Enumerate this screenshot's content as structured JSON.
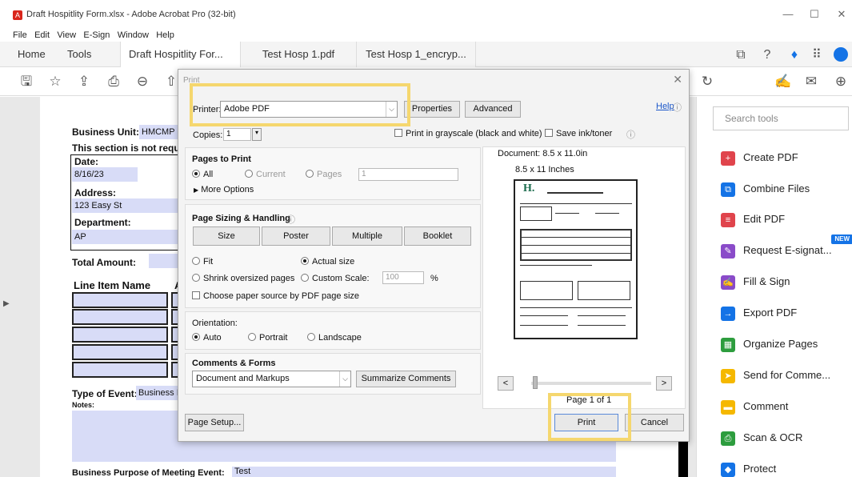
{
  "window": {
    "title": "Draft Hospitlity Form.xlsx - Adobe Acrobat Pro (32-bit)",
    "minimize": "—",
    "maximize": "☐",
    "close": "✕"
  },
  "menu": [
    "File",
    "Edit",
    "View",
    "E-Sign",
    "Window",
    "Help"
  ],
  "tabs": {
    "home": "Home",
    "tools": "Tools",
    "docs": [
      {
        "label": "Draft Hospitlity For...",
        "close": "×"
      },
      {
        "label": "Test Hosp 1.pdf"
      },
      {
        "label": "Test Hosp 1_encryp..."
      }
    ]
  },
  "document": {
    "business_unit_label": "Business Unit:",
    "business_unit_value": "HMCMP",
    "section_note": "This section is not requir",
    "date_label": "Date:",
    "date_value": "8/16/23",
    "address_label": "Address:",
    "address_value": "123 Easy St",
    "department_label": "Department:",
    "department_value": "AP",
    "total_amount_label": "Total Amount:",
    "line_item_label": "Line Item Name",
    "line_item_col2": "A",
    "type_of_event_label": "Type of Event:",
    "type_of_event_value": "Business I",
    "notes_label": "Notes:",
    "business_purpose_label": "Business Purpose of Meeting Event:",
    "business_purpose_value": "Test"
  },
  "tools_pane": {
    "search_placeholder": "Search tools",
    "items": [
      {
        "label": "Create PDF",
        "color": "#e0444c"
      },
      {
        "label": "Combine Files",
        "color": "#1473e6"
      },
      {
        "label": "Edit PDF",
        "color": "#e0444c"
      },
      {
        "label": "Request E-signat...",
        "color": "#8a4bc9",
        "badge": "NEW"
      },
      {
        "label": "Fill & Sign",
        "color": "#8a4bc9"
      },
      {
        "label": "Export PDF",
        "color": "#1473e6"
      },
      {
        "label": "Organize Pages",
        "color": "#2d9d3e"
      },
      {
        "label": "Send for Comme...",
        "color": "#f5b800"
      },
      {
        "label": "Comment",
        "color": "#f5b800"
      },
      {
        "label": "Scan & OCR",
        "color": "#2d9d3e"
      },
      {
        "label": "Protect",
        "color": "#1473e6"
      }
    ]
  },
  "print_dialog": {
    "title": "Print",
    "printer_label": "Printer:",
    "printer_value": "Adobe PDF",
    "properties_button": "Properties",
    "advanced_button": "Advanced",
    "help_link": "Help",
    "copies_label": "Copies:",
    "copies_value": "1",
    "grayscale_label": "Print in grayscale (black and white)",
    "save_ink_label": "Save ink/toner",
    "pages_to_print": {
      "title": "Pages to Print",
      "all": "All",
      "current": "Current",
      "pages": "Pages",
      "pages_value": "1",
      "more_options": "More Options"
    },
    "page_sizing": {
      "title": "Page Sizing & Handling",
      "size_button": "Size",
      "poster_button": "Poster",
      "multiple_button": "Multiple",
      "booklet_button": "Booklet",
      "fit": "Fit",
      "actual_size": "Actual size",
      "shrink": "Shrink oversized pages",
      "custom_scale": "Custom Scale:",
      "custom_scale_value": "100",
      "percent": "%",
      "paper_source": "Choose paper source by PDF page size"
    },
    "orientation": {
      "title": "Orientation:",
      "auto": "Auto",
      "portrait": "Portrait",
      "landscape": "Landscape"
    },
    "comments_forms": {
      "title": "Comments & Forms",
      "value": "Document and Markups",
      "summarize_button": "Summarize Comments"
    },
    "preview": {
      "document_size": "Document: 8.5 x 11.0in",
      "paper_size": "8.5 x 11 Inches",
      "page_indicator": "Page 1 of 1",
      "prev": "<",
      "next": ">"
    },
    "page_setup_button": "Page Setup...",
    "print_button": "Print",
    "cancel_button": "Cancel"
  },
  "highlight_color": "#f5d76e"
}
